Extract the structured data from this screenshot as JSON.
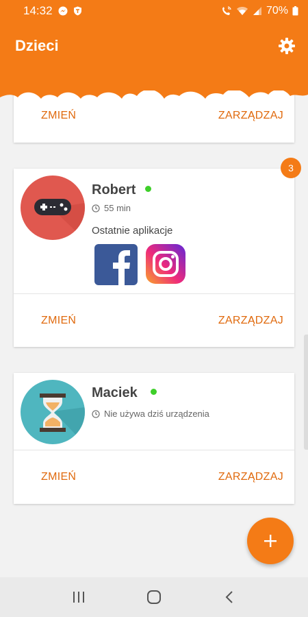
{
  "status_bar": {
    "time": "14:32",
    "battery": "70%"
  },
  "app_bar": {
    "title": "Dzieci",
    "settings_icon": "gear-icon"
  },
  "colors": {
    "accent": "#f47b16",
    "action_text": "#e06a0e",
    "online": "#3ecf2a"
  },
  "cards": [
    {
      "change_label": "ZMIEŃ",
      "manage_label": "ZARZĄDZAJ"
    },
    {
      "name": "Robert",
      "online": true,
      "usage": "55 min",
      "recent_label": "Ostatnie aplikacje",
      "recent_apps": [
        "facebook-icon",
        "instagram-icon"
      ],
      "badge": "3",
      "avatar_icon": "gamepad-icon",
      "change_label": "ZMIEŃ",
      "manage_label": "ZARZĄDZAJ"
    },
    {
      "name": "Maciek",
      "online": true,
      "usage": "Nie używa dziś urządzenia",
      "avatar_icon": "hourglass-icon",
      "change_label": "ZMIEŃ",
      "manage_label": "ZARZĄDZAJ"
    }
  ],
  "fab": {
    "icon": "plus-icon"
  },
  "nav_bar": {
    "icons": [
      "recent-apps-icon",
      "home-icon",
      "back-icon"
    ]
  }
}
